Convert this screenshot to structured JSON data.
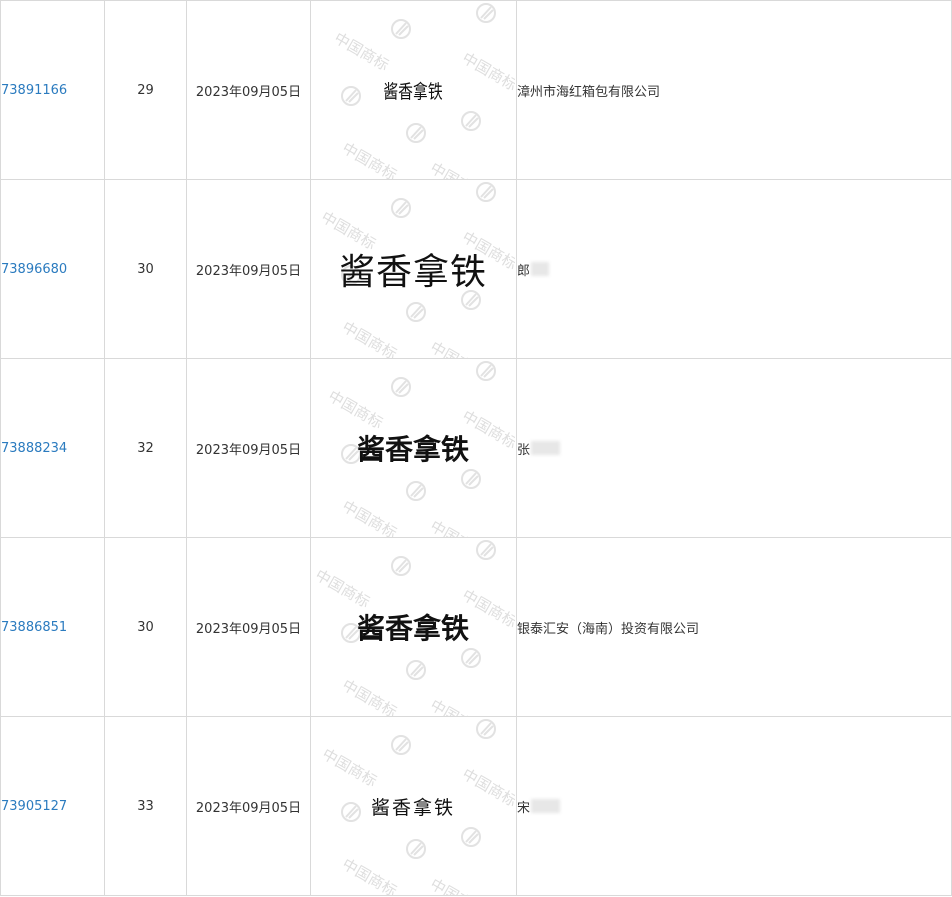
{
  "columns": [
    "registration_number",
    "class",
    "application_date",
    "trademark_image",
    "applicant"
  ],
  "rows": [
    {
      "reg": "73891166",
      "cls": "29",
      "date": "2023年09月05日",
      "mark": "酱香拿铁",
      "owner": "漳州市海红箱包有限公司",
      "owner_redacted": false
    },
    {
      "reg": "73896680",
      "cls": "30",
      "date": "2023年09月05日",
      "mark": "酱香拿铁",
      "owner": "郎",
      "owner_redacted": true
    },
    {
      "reg": "73888234",
      "cls": "32",
      "date": "2023年09月05日",
      "mark": "酱香拿铁",
      "owner": "张",
      "owner_redacted": true
    },
    {
      "reg": "73886851",
      "cls": "30",
      "date": "2023年09月05日",
      "mark": "酱香拿铁",
      "owner": "银泰汇安（海南）投资有限公司",
      "owner_redacted": false
    },
    {
      "reg": "73905127",
      "cls": "33",
      "date": "2023年09月05日",
      "mark": "酱香拿铁",
      "owner": "宋",
      "owner_redacted": true
    }
  ],
  "watermark_text": "中国商标",
  "colors": {
    "link": "#2b7bbf",
    "border": "#d9d9d9",
    "text": "#333333"
  }
}
